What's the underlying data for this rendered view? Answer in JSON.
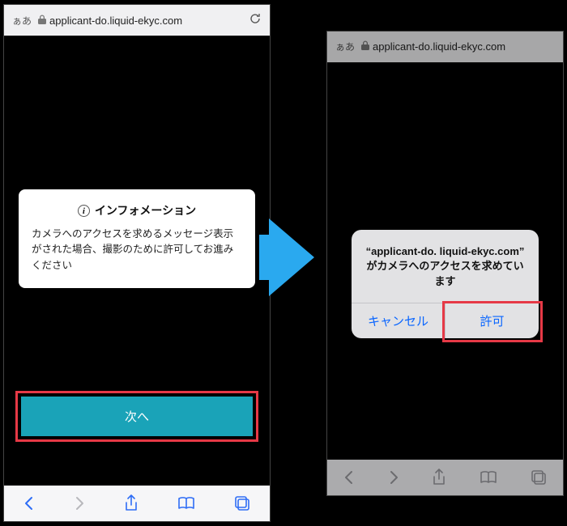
{
  "left": {
    "addr": {
      "aa": "ぁあ",
      "url": "applicant-do.liquid-ekyc.com"
    },
    "info": {
      "title": "インフォメーション",
      "body": "カメラへのアクセスを求めるメッセージ表示がされた場合、撮影のために許可してお進みください"
    },
    "next_label": "次へ"
  },
  "right": {
    "addr": {
      "aa": "ぁあ",
      "url": "applicant-do.liquid-ekyc.com"
    },
    "alert": {
      "message": "“applicant-do.\nliquid-ekyc.com” がカメラへのアクセスを求めています",
      "cancel": "キャンセル",
      "allow": "許可"
    }
  },
  "icons": {
    "lock": "lock-icon",
    "refresh": "refresh-icon",
    "back": "back-icon",
    "forward": "forward-icon",
    "share": "share-icon",
    "bookmarks": "bookmarks-icon",
    "tabs": "tabs-icon",
    "info": "info-icon"
  }
}
